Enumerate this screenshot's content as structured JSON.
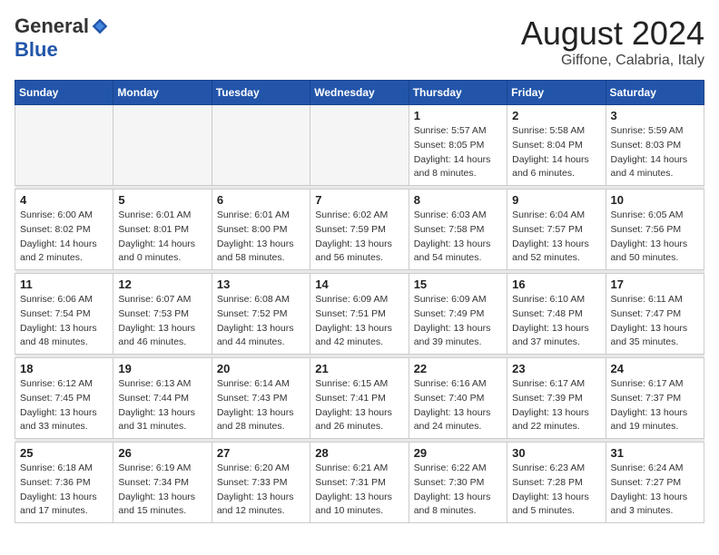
{
  "header": {
    "logo_general": "General",
    "logo_blue": "Blue",
    "month": "August 2024",
    "location": "Giffone, Calabria, Italy"
  },
  "days_of_week": [
    "Sunday",
    "Monday",
    "Tuesday",
    "Wednesday",
    "Thursday",
    "Friday",
    "Saturday"
  ],
  "weeks": [
    [
      {
        "num": "",
        "info": ""
      },
      {
        "num": "",
        "info": ""
      },
      {
        "num": "",
        "info": ""
      },
      {
        "num": "",
        "info": ""
      },
      {
        "num": "1",
        "info": "Sunrise: 5:57 AM\nSunset: 8:05 PM\nDaylight: 14 hours\nand 8 minutes."
      },
      {
        "num": "2",
        "info": "Sunrise: 5:58 AM\nSunset: 8:04 PM\nDaylight: 14 hours\nand 6 minutes."
      },
      {
        "num": "3",
        "info": "Sunrise: 5:59 AM\nSunset: 8:03 PM\nDaylight: 14 hours\nand 4 minutes."
      }
    ],
    [
      {
        "num": "4",
        "info": "Sunrise: 6:00 AM\nSunset: 8:02 PM\nDaylight: 14 hours\nand 2 minutes."
      },
      {
        "num": "5",
        "info": "Sunrise: 6:01 AM\nSunset: 8:01 PM\nDaylight: 14 hours\nand 0 minutes."
      },
      {
        "num": "6",
        "info": "Sunrise: 6:01 AM\nSunset: 8:00 PM\nDaylight: 13 hours\nand 58 minutes."
      },
      {
        "num": "7",
        "info": "Sunrise: 6:02 AM\nSunset: 7:59 PM\nDaylight: 13 hours\nand 56 minutes."
      },
      {
        "num": "8",
        "info": "Sunrise: 6:03 AM\nSunset: 7:58 PM\nDaylight: 13 hours\nand 54 minutes."
      },
      {
        "num": "9",
        "info": "Sunrise: 6:04 AM\nSunset: 7:57 PM\nDaylight: 13 hours\nand 52 minutes."
      },
      {
        "num": "10",
        "info": "Sunrise: 6:05 AM\nSunset: 7:56 PM\nDaylight: 13 hours\nand 50 minutes."
      }
    ],
    [
      {
        "num": "11",
        "info": "Sunrise: 6:06 AM\nSunset: 7:54 PM\nDaylight: 13 hours\nand 48 minutes."
      },
      {
        "num": "12",
        "info": "Sunrise: 6:07 AM\nSunset: 7:53 PM\nDaylight: 13 hours\nand 46 minutes."
      },
      {
        "num": "13",
        "info": "Sunrise: 6:08 AM\nSunset: 7:52 PM\nDaylight: 13 hours\nand 44 minutes."
      },
      {
        "num": "14",
        "info": "Sunrise: 6:09 AM\nSunset: 7:51 PM\nDaylight: 13 hours\nand 42 minutes."
      },
      {
        "num": "15",
        "info": "Sunrise: 6:09 AM\nSunset: 7:49 PM\nDaylight: 13 hours\nand 39 minutes."
      },
      {
        "num": "16",
        "info": "Sunrise: 6:10 AM\nSunset: 7:48 PM\nDaylight: 13 hours\nand 37 minutes."
      },
      {
        "num": "17",
        "info": "Sunrise: 6:11 AM\nSunset: 7:47 PM\nDaylight: 13 hours\nand 35 minutes."
      }
    ],
    [
      {
        "num": "18",
        "info": "Sunrise: 6:12 AM\nSunset: 7:45 PM\nDaylight: 13 hours\nand 33 minutes."
      },
      {
        "num": "19",
        "info": "Sunrise: 6:13 AM\nSunset: 7:44 PM\nDaylight: 13 hours\nand 31 minutes."
      },
      {
        "num": "20",
        "info": "Sunrise: 6:14 AM\nSunset: 7:43 PM\nDaylight: 13 hours\nand 28 minutes."
      },
      {
        "num": "21",
        "info": "Sunrise: 6:15 AM\nSunset: 7:41 PM\nDaylight: 13 hours\nand 26 minutes."
      },
      {
        "num": "22",
        "info": "Sunrise: 6:16 AM\nSunset: 7:40 PM\nDaylight: 13 hours\nand 24 minutes."
      },
      {
        "num": "23",
        "info": "Sunrise: 6:17 AM\nSunset: 7:39 PM\nDaylight: 13 hours\nand 22 minutes."
      },
      {
        "num": "24",
        "info": "Sunrise: 6:17 AM\nSunset: 7:37 PM\nDaylight: 13 hours\nand 19 minutes."
      }
    ],
    [
      {
        "num": "25",
        "info": "Sunrise: 6:18 AM\nSunset: 7:36 PM\nDaylight: 13 hours\nand 17 minutes."
      },
      {
        "num": "26",
        "info": "Sunrise: 6:19 AM\nSunset: 7:34 PM\nDaylight: 13 hours\nand 15 minutes."
      },
      {
        "num": "27",
        "info": "Sunrise: 6:20 AM\nSunset: 7:33 PM\nDaylight: 13 hours\nand 12 minutes."
      },
      {
        "num": "28",
        "info": "Sunrise: 6:21 AM\nSunset: 7:31 PM\nDaylight: 13 hours\nand 10 minutes."
      },
      {
        "num": "29",
        "info": "Sunrise: 6:22 AM\nSunset: 7:30 PM\nDaylight: 13 hours\nand 8 minutes."
      },
      {
        "num": "30",
        "info": "Sunrise: 6:23 AM\nSunset: 7:28 PM\nDaylight: 13 hours\nand 5 minutes."
      },
      {
        "num": "31",
        "info": "Sunrise: 6:24 AM\nSunset: 7:27 PM\nDaylight: 13 hours\nand 3 minutes."
      }
    ]
  ]
}
